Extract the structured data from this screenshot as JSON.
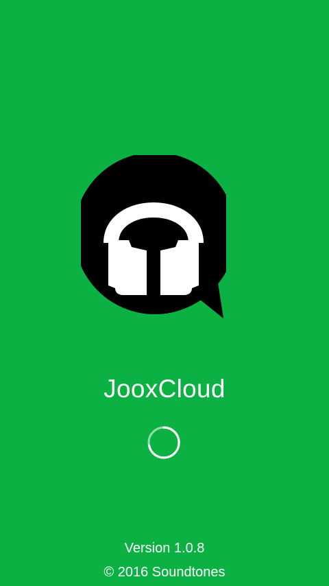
{
  "app": {
    "name": "JooxCloud",
    "version_text": "Version 1.0.8",
    "copyright_text": "© 2016 Soundtones"
  },
  "logo": {
    "icon": "headphones-chat-bubble-icon"
  },
  "loading": {
    "icon": "loading-spinner-icon"
  },
  "colors": {
    "background": "#0bb243",
    "logo_bubble": "#000000",
    "logo_headphones": "#ffffff",
    "text": "#ffffff"
  }
}
